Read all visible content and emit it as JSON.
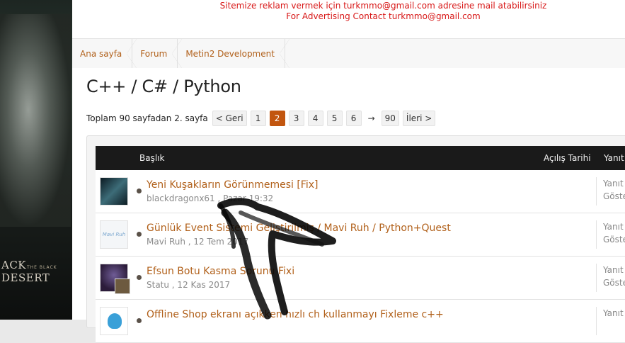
{
  "side_banner": {
    "brand": "ACK DESERT",
    "brand_sub": "THE BLACK"
  },
  "ad": {
    "line1": "Sitemize reklam vermek için turkmmo@gmail.com adresine mail atabilirsiniz",
    "line2": "For Advertising Contact turkmmo@gmail.com"
  },
  "breadcrumb": [
    "Ana sayfa",
    "Forum",
    "Metin2 Development"
  ],
  "page_title": "C++ / C# / Python",
  "pagination": {
    "label": "Toplam 90 sayfadan 2. sayfa",
    "prev": "< Geri",
    "pages": [
      "1",
      "2",
      "3",
      "4",
      "5",
      "6"
    ],
    "current": "2",
    "ellipsis": "→",
    "last": "90",
    "next": "İleri >"
  },
  "table": {
    "headers": {
      "title": "Başlık",
      "date": "Açılış Tarihi",
      "replies": "Yanıt"
    },
    "rows": [
      {
        "title": "Yeni Kuşakların Görünmemesi [Fix]",
        "meta": "blackdragonx61 , Pazar 19:32",
        "stats": [
          "Yanıt",
          "Göste"
        ]
      },
      {
        "title": "Günlük Event Sistemi Geliştirilmiş / Mavi Ruh / Python+Quest",
        "meta": "Mavi Ruh , 12 Tem 2017",
        "stats": [
          "Yanıt",
          "Göste"
        ]
      },
      {
        "title": "Efsun Botu Kasma Sorunu Fixi",
        "meta": "Statu , 12 Kas 2017",
        "stats": [
          "Yanıt",
          "Göste"
        ]
      },
      {
        "title": "Offline Shop ekranı açıkken hızlı ch kullanmayı Fixleme c++",
        "meta": "",
        "stats": [
          "Yanıt",
          ""
        ]
      }
    ]
  },
  "colors": {
    "accent": "#b1601a",
    "active_page": "#c2560f",
    "ad_text": "#d81818",
    "header_bg": "#1a1a1a"
  }
}
